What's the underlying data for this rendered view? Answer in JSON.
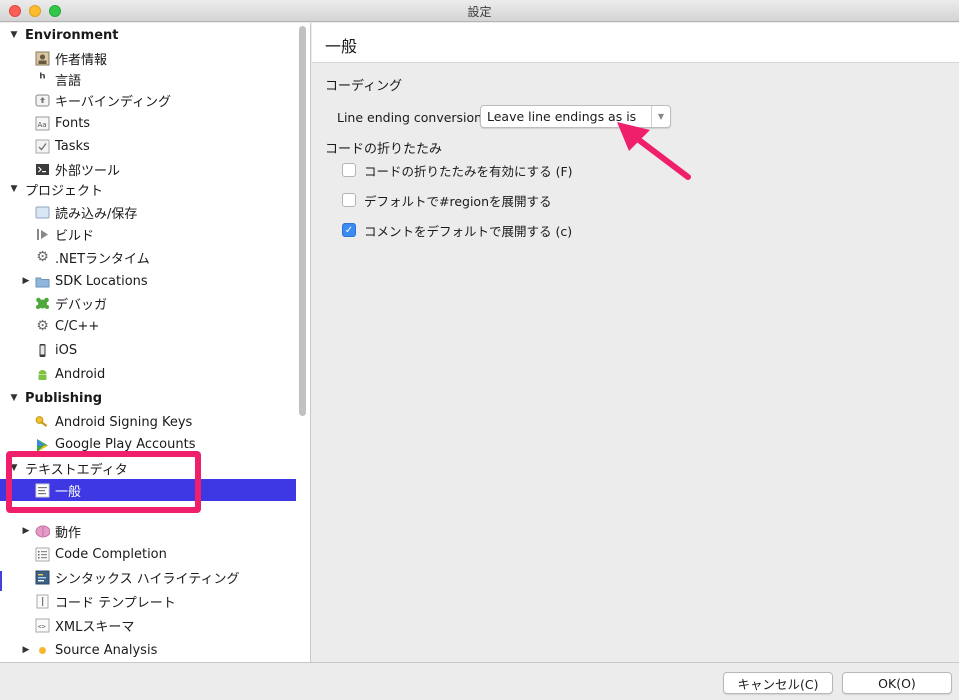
{
  "window": {
    "title": "設定"
  },
  "sidebar": {
    "items": [
      {
        "label": "Environment",
        "kind": "category",
        "icon": "triangle-down-icon"
      },
      {
        "label": "作者情報",
        "kind": "item",
        "icon": "author-icon"
      },
      {
        "label": "言語",
        "kind": "item",
        "icon": "language-icon"
      },
      {
        "label": "キーバインディング",
        "kind": "item",
        "icon": "keybinding-icon"
      },
      {
        "label": "Fonts",
        "kind": "item",
        "icon": "fonts-icon"
      },
      {
        "label": "Tasks",
        "kind": "item",
        "icon": "tasks-icon"
      },
      {
        "label": "外部ツール",
        "kind": "item",
        "icon": "terminal-icon"
      },
      {
        "label": "プロジェクト",
        "kind": "category",
        "icon": "triangle-down-icon"
      },
      {
        "label": "読み込み/保存",
        "kind": "item",
        "icon": "load-save-icon"
      },
      {
        "label": "ビルド",
        "kind": "item",
        "icon": "build-icon"
      },
      {
        "label": ".NETランタイム",
        "kind": "item",
        "icon": "gear-icon"
      },
      {
        "label": "SDK Locations",
        "kind": "item",
        "icon": "folder-icon"
      },
      {
        "label": "デバッガ",
        "kind": "item",
        "icon": "debugger-icon"
      },
      {
        "label": "C/C++",
        "kind": "item",
        "icon": "gear-icon"
      },
      {
        "label": "iOS",
        "kind": "item",
        "icon": "iphone-icon"
      },
      {
        "label": "Android",
        "kind": "item",
        "icon": "android-icon"
      },
      {
        "label": "Publishing",
        "kind": "category",
        "icon": "triangle-down-icon"
      },
      {
        "label": "Android Signing Keys",
        "kind": "item",
        "icon": "key-icon"
      },
      {
        "label": "Google Play Accounts",
        "kind": "item",
        "icon": "google-play-icon"
      },
      {
        "label": "テキストエディタ",
        "kind": "category",
        "icon": "triangle-down-icon"
      },
      {
        "label": "一般",
        "kind": "item",
        "icon": "text-editor-icon",
        "selected": true
      },
      {
        "label": "動作",
        "kind": "item",
        "icon": "brain-icon"
      },
      {
        "label": "Code Completion",
        "kind": "item",
        "icon": "list-icon"
      },
      {
        "label": "シンタックス ハイライティング",
        "kind": "item",
        "icon": "syntax-icon"
      },
      {
        "label": "コード テンプレート",
        "kind": "item",
        "icon": "template-icon"
      },
      {
        "label": "XMLスキーマ",
        "kind": "item",
        "icon": "xml-icon"
      },
      {
        "label": "Source Analysis",
        "kind": "item",
        "icon": "dot-icon"
      }
    ]
  },
  "main": {
    "title": "一般",
    "section_coding": "コーディング",
    "line_ending_label": "Line ending conversion:",
    "line_ending_value": "Leave line endings as is",
    "section_folding": "コードの折りたたみ",
    "checkboxes": [
      {
        "label": "コードの折りたたみを有効にする (F)",
        "checked": false
      },
      {
        "label": "デフォルトで#regionを展開する",
        "checked": false
      },
      {
        "label": "コメントをデフォルトで展開する (c)",
        "checked": true
      }
    ]
  },
  "footer": {
    "cancel_label": "キャンセル(C)",
    "ok_label": "OK(O)"
  },
  "colors": {
    "selection": "#3d37e4",
    "annotation": "#f01f6c",
    "checkbox_checked": "#3d8bf2"
  }
}
